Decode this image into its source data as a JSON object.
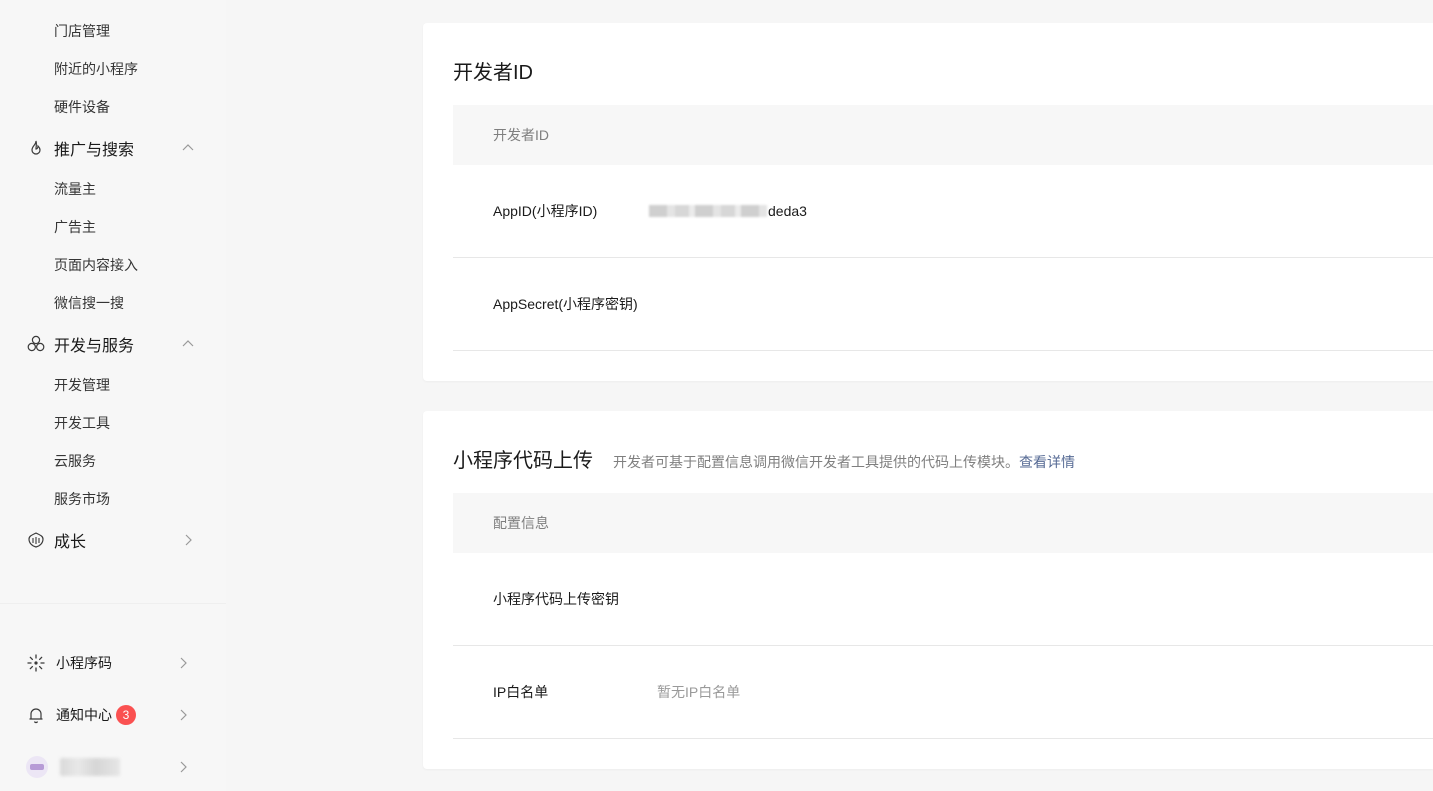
{
  "sidebar": {
    "top_items": [
      "门店管理",
      "附近的小程序",
      "硬件设备"
    ],
    "promotion": {
      "label": "推广与搜索",
      "icon": "flame-icon",
      "items": [
        "流量主",
        "广告主",
        "页面内容接入",
        "微信搜一搜"
      ]
    },
    "dev": {
      "label": "开发与服务",
      "icon": "circles-icon",
      "items": [
        "开发管理",
        "开发工具",
        "云服务",
        "服务市场"
      ]
    },
    "growth": {
      "label": "成长",
      "icon": "growth-icon"
    },
    "bottom": {
      "qrcode": {
        "label": "小程序码",
        "icon": "qrcode-icon"
      },
      "notify": {
        "label": "通知中心",
        "icon": "bell-icon",
        "badge": "3"
      },
      "account": {
        "icon": "avatar"
      }
    }
  },
  "dev_id_card": {
    "title": "开发者ID",
    "header": "开发者ID",
    "rows": [
      {
        "label": "AppID(小程序ID)",
        "value_suffix": "deda3"
      },
      {
        "label": "AppSecret(小程序密钥)"
      }
    ]
  },
  "upload_card": {
    "title": "小程序代码上传",
    "desc": "开发者可基于配置信息调用微信开发者工具提供的代码上传模块。",
    "link": "查看详情",
    "header": "配置信息",
    "rows": [
      {
        "label": "小程序代码上传密钥"
      },
      {
        "label": "IP白名单",
        "value": "暂无IP白名单"
      }
    ]
  },
  "colors": {
    "link": "#576b95",
    "badge": "#fa5151",
    "muted": "#7f7f7f"
  }
}
